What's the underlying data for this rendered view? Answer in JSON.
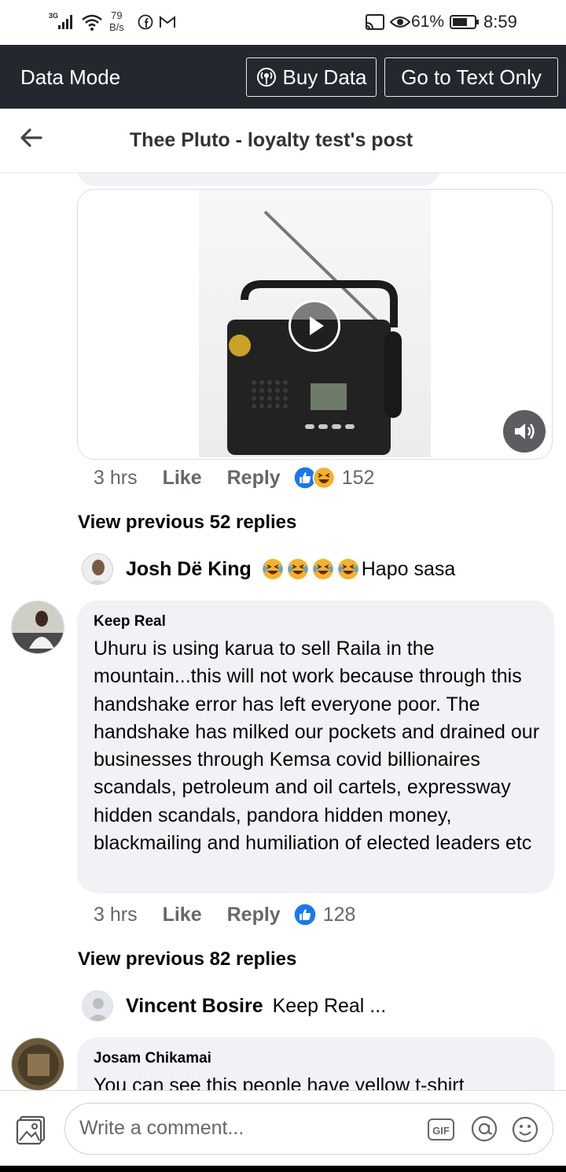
{
  "status_bar": {
    "network_type": "3G",
    "net_speed_value": "79",
    "net_speed_unit": "B/s",
    "battery_percent": "61%",
    "time": "8:59",
    "icons": [
      "signal-icon",
      "wifi-icon",
      "facebook-icon",
      "gmail-icon",
      "cast-icon",
      "eye-comfort-icon",
      "battery-icon"
    ]
  },
  "data_bar": {
    "label": "Data Mode",
    "buy_data": "Buy Data",
    "text_only": "Go to Text Only"
  },
  "header": {
    "title": "Thee Pluto - loyalty test's post",
    "back_icon": "back-arrow-icon"
  },
  "comments": [
    {
      "type": "video",
      "meta": {
        "time": "3 hrs",
        "like": "Like",
        "reply": "Reply",
        "reactions": [
          "like",
          "haha"
        ],
        "count": "152"
      },
      "view_previous": "View previous 52 replies",
      "reply_preview": {
        "name": "Josh Dë King",
        "emoji_count": 4,
        "text": "Hapo sasa"
      }
    },
    {
      "type": "text",
      "author": "Keep Real",
      "text": "Uhuru is using karua to sell Raila in the mountain...this will not work because through this handshake error has left everyone poor. The handshake has milked our pockets and drained our businesses through Kemsa covid billionaires scandals,  petroleum and oil cartels, expressway hidden scandals, pandora hidden money, blackmailing and humiliation of elected leaders etc",
      "meta": {
        "time": "3 hrs",
        "like": "Like",
        "reply": "Reply",
        "reactions": [
          "like"
        ],
        "count": "128"
      },
      "view_previous": "View previous 82 replies",
      "reply_preview": {
        "name": "Vincent Bosire",
        "text": "Keep Real ..."
      }
    },
    {
      "type": "text",
      "author": "Josam Chikamai",
      "text": "You can see this people have yellow t-shirt"
    }
  ],
  "composer": {
    "placeholder": "Write a comment...",
    "gif_label": "GIF"
  },
  "colors": {
    "data_bar_bg": "#23282f",
    "bubble_bg": "#f0f2f5",
    "like_blue": "#1877f2",
    "secondary_text": "#65676b"
  }
}
